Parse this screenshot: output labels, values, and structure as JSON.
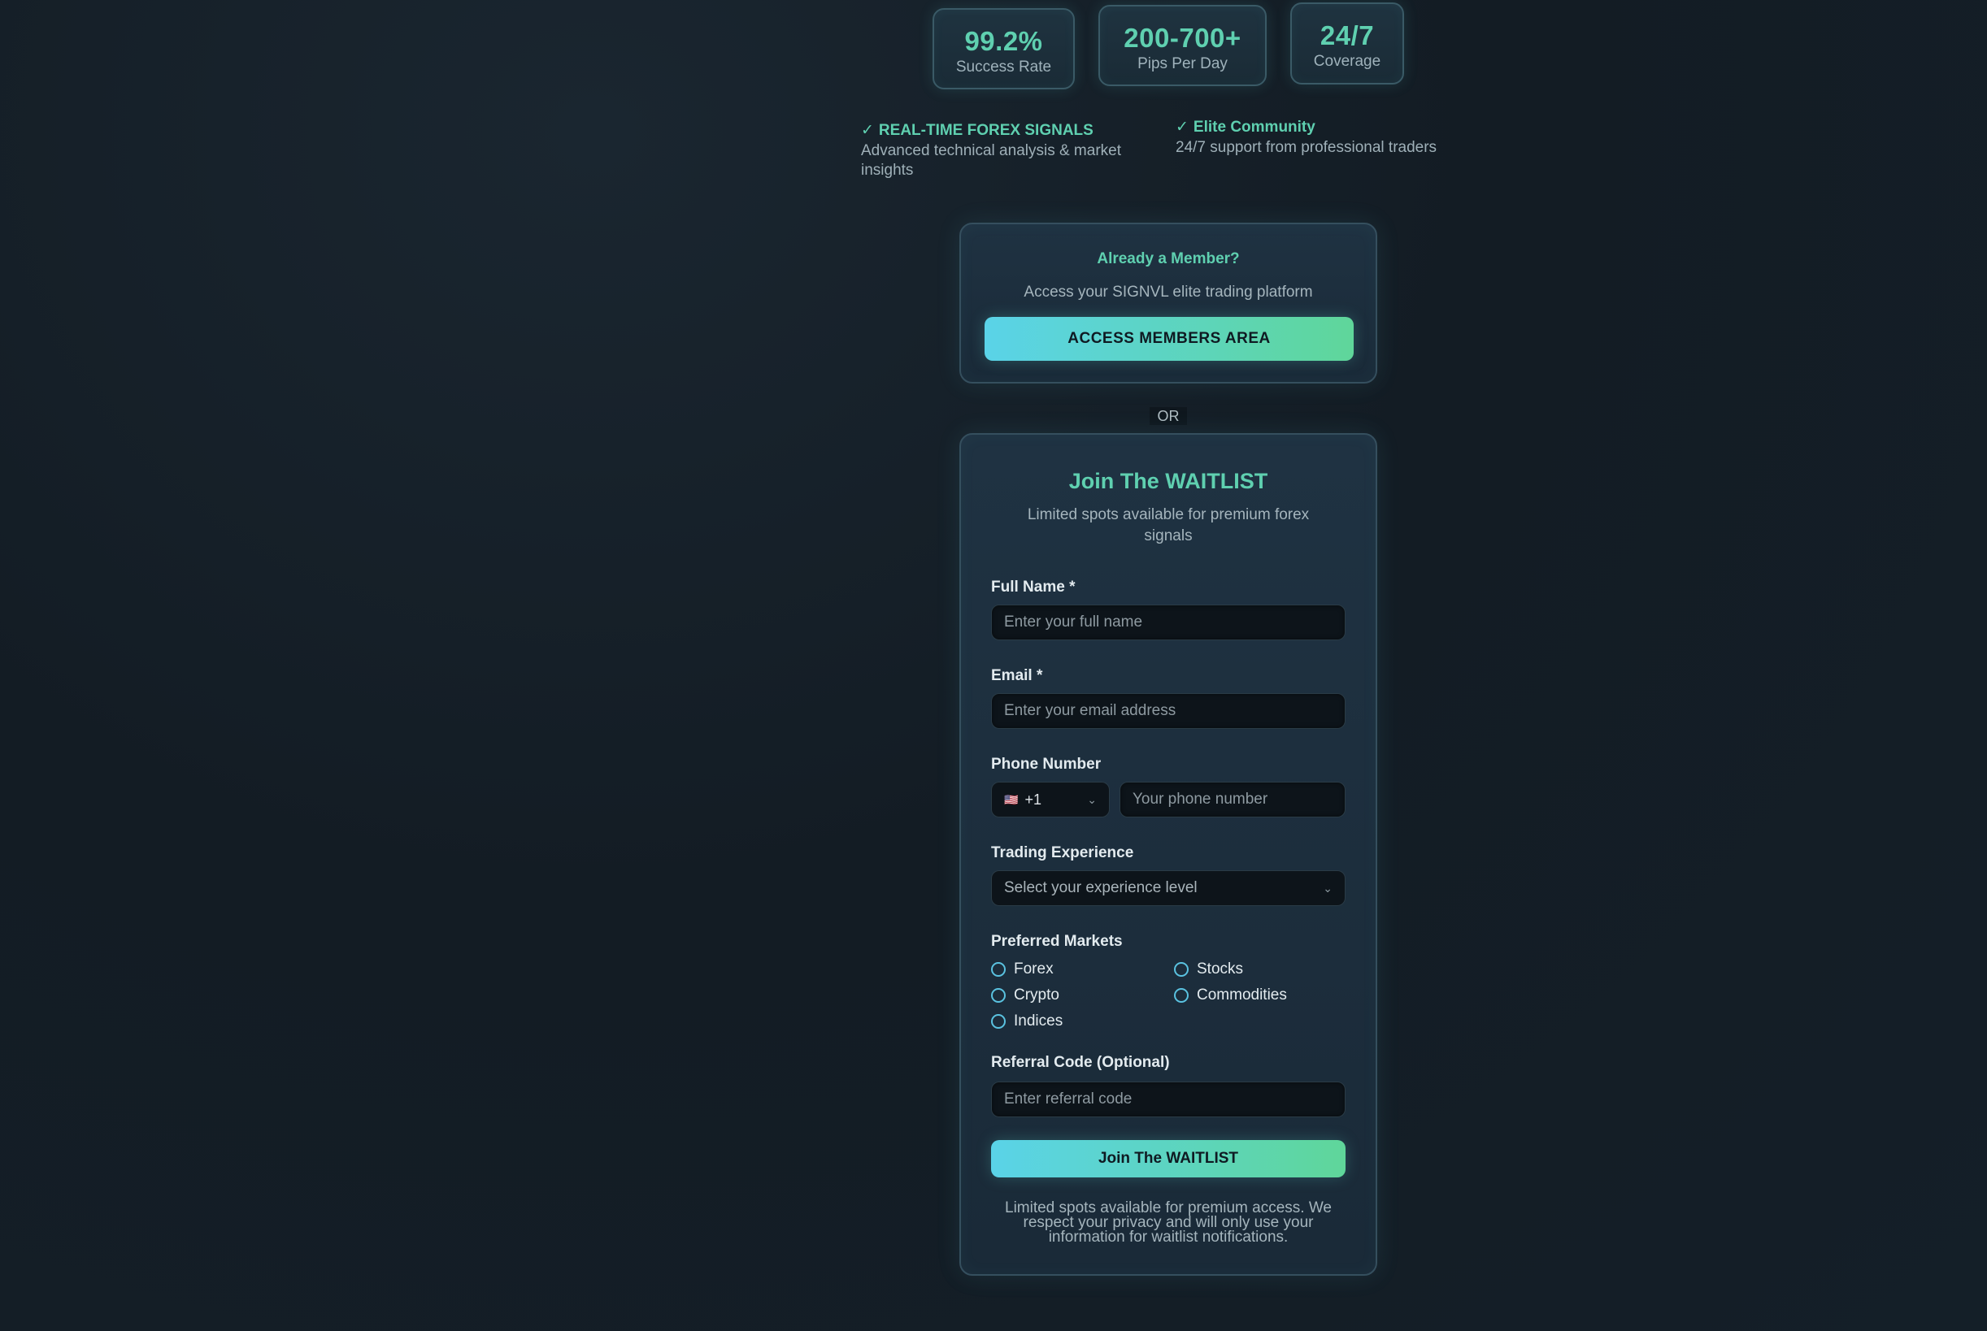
{
  "stats": [
    {
      "value": "99.2%",
      "label": "Success Rate"
    },
    {
      "value": "200-700+",
      "label": "Pips Per Day"
    },
    {
      "value": "24/7",
      "label": "Coverage"
    }
  ],
  "features": [
    {
      "check": "✓",
      "title": "REAL-TIME FOREX SIGNALS",
      "description": "Advanced technical analysis & market insights"
    },
    {
      "check": "✓",
      "title": "Elite Community",
      "description": "24/7 support from professional traders"
    }
  ],
  "member": {
    "title": "Already a Member?",
    "subtitle": "Access your SIGNVL elite trading platform",
    "button": "ACCESS MEMBERS AREA"
  },
  "divider": "OR",
  "waitlist": {
    "title": "Join The WAITLIST",
    "subtitle": "Limited spots available for premium forex signals",
    "full_name_label": "Full Name *",
    "full_name_placeholder": "Enter your full name",
    "email_label": "Email *",
    "email_placeholder": "Enter your email address",
    "phone_label": "Phone Number",
    "country_flag": "🇺🇸",
    "country_code": "+1",
    "phone_placeholder": "Your phone number",
    "experience_label": "Trading Experience",
    "experience_placeholder": "Select your experience level",
    "markets_label": "Preferred Markets",
    "markets": [
      "Forex",
      "Stocks",
      "Crypto",
      "Commodities",
      "Indices"
    ],
    "referral_label": "Referral Code (Optional)",
    "referral_placeholder": "Enter referral code",
    "submit": "Join The WAITLIST",
    "privacy": "Limited spots available for premium access. We respect your privacy and will only use your information for waitlist notifications."
  },
  "colors": {
    "accent": "#5fd0b0",
    "button_gradient_start": "#5ad3e8",
    "button_gradient_end": "#5fd69a",
    "background": "#141f28"
  }
}
